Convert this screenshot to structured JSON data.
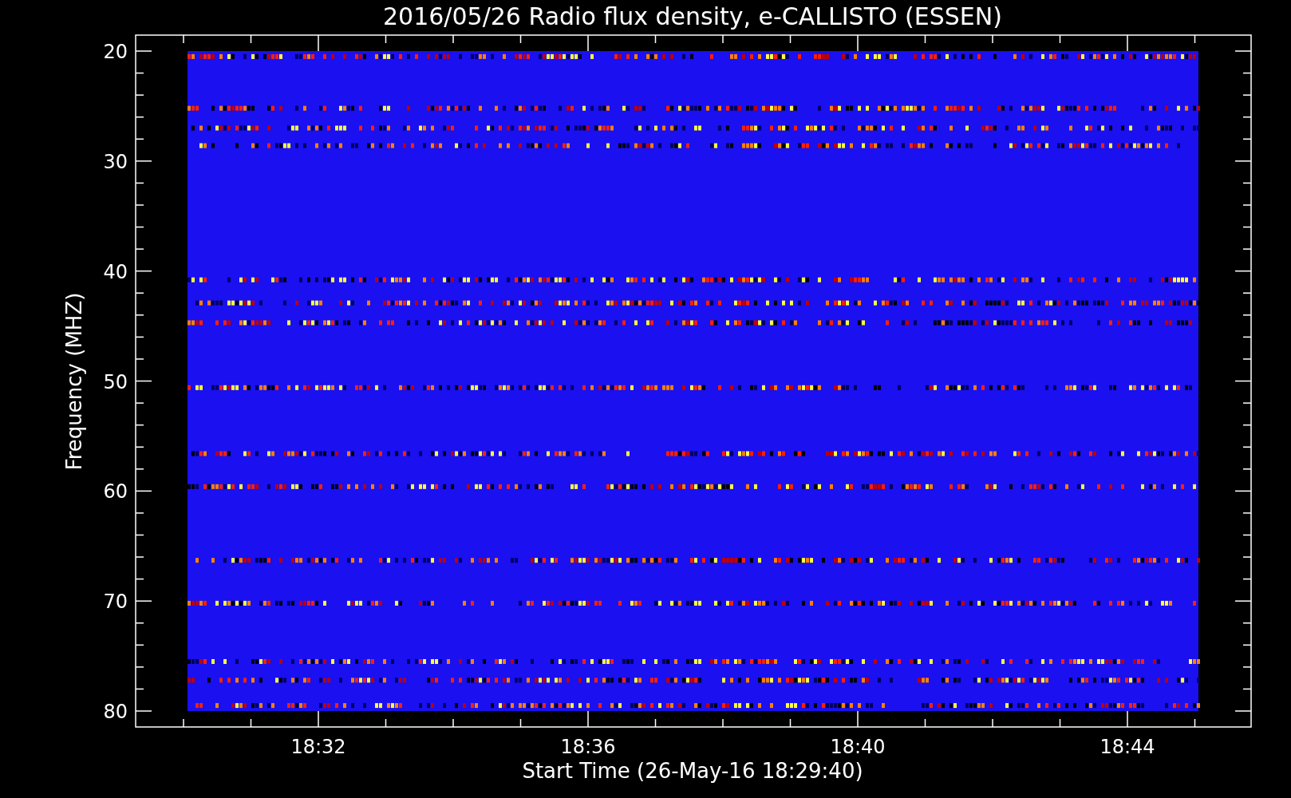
{
  "title": "2016/05/26  Radio flux density, e-CALLISTO (ESSEN)",
  "y_axis": {
    "label": "Frequency (MHZ)",
    "ticks": [
      "20",
      "30",
      "40",
      "50",
      "60",
      "70",
      "80"
    ]
  },
  "x_axis": {
    "label": "Start Time (26-May-16 18:29:40)",
    "ticks": [
      "18:32",
      "18:36",
      "18:40",
      "18:44"
    ]
  }
}
